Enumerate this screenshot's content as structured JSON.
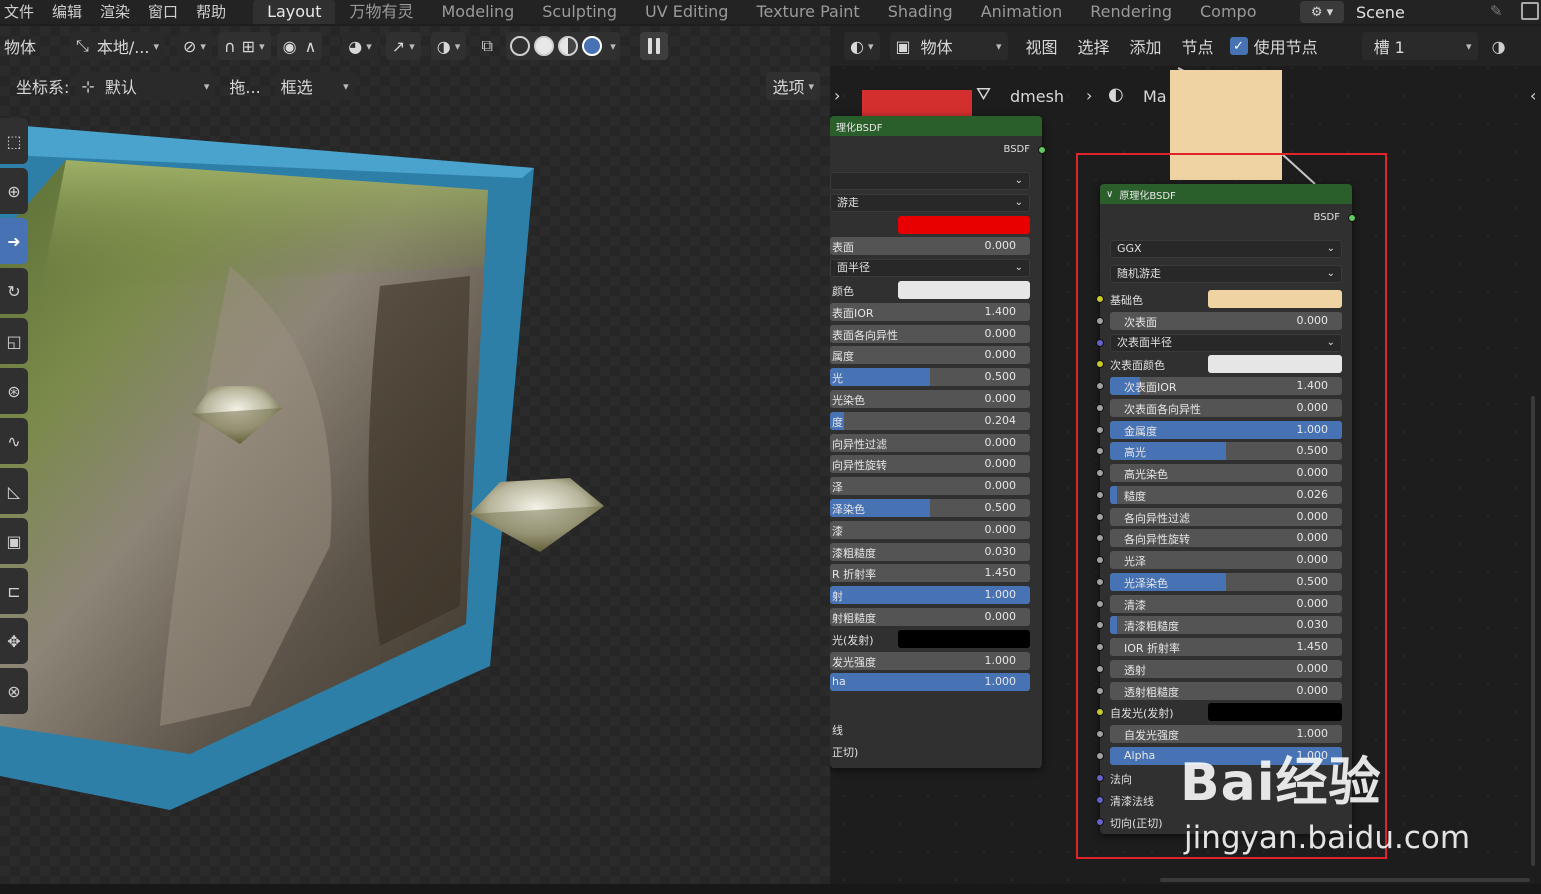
{
  "topbar": {
    "menus": [
      "文件",
      "编辑",
      "渲染",
      "窗口",
      "帮助"
    ],
    "workspaces": [
      "Layout",
      "万物有灵",
      "Modeling",
      "Sculpting",
      "UV Editing",
      "Texture Paint",
      "Shading",
      "Animation",
      "Rendering",
      "Compo"
    ],
    "active_workspace": "Layout",
    "scene_name": "Scene"
  },
  "viewport": {
    "mode_label": "物体",
    "orientation_label": "本地/...",
    "coord_label": "坐标系:",
    "coord_value": "默认",
    "drag_label": "拖...",
    "select_mode": "框选",
    "options_label": "选项"
  },
  "node_editor": {
    "object_label": "物体",
    "menus": [
      "视图",
      "选择",
      "添加",
      "节点"
    ],
    "use_nodes_label": "使用节点",
    "slot_label": "槽 1",
    "breadcrumb_mesh": "dmesh",
    "breadcrumb_mat": "Ma"
  },
  "left_node": {
    "title": "理化BSDF",
    "output": "BSDF",
    "rows": [
      {
        "label": "",
        "kind": "dropdown"
      },
      {
        "label": "游走",
        "kind": "dropdown"
      },
      {
        "label": "",
        "kind": "color",
        "color": "#e80000"
      },
      {
        "label": "表面",
        "value": "0.000",
        "fill": 0
      },
      {
        "label": "面半径",
        "kind": "dropdown"
      },
      {
        "label": "颜色",
        "kind": "color",
        "color": "#e6e6e6"
      },
      {
        "label": "表面IOR",
        "value": "1.400",
        "fill": 0
      },
      {
        "label": "表面各向异性",
        "value": "0.000",
        "fill": 0
      },
      {
        "label": "属度",
        "value": "0.000",
        "fill": 0
      },
      {
        "label": "光",
        "value": "0.500",
        "fill": 0.5
      },
      {
        "label": "光染色",
        "value": "0.000",
        "fill": 0
      },
      {
        "label": "度",
        "value": "0.204",
        "fill": 0.07
      },
      {
        "label": "向异性过滤",
        "value": "0.000",
        "fill": 0
      },
      {
        "label": "向异性旋转",
        "value": "0.000",
        "fill": 0
      },
      {
        "label": "泽",
        "value": "0.000",
        "fill": 0
      },
      {
        "label": "泽染色",
        "value": "0.500",
        "fill": 0.5
      },
      {
        "label": "漆",
        "value": "0.000",
        "fill": 0
      },
      {
        "label": "漆粗糙度",
        "value": "0.030",
        "fill": 0
      },
      {
        "label": "R 折射率",
        "value": "1.450",
        "fill": 0
      },
      {
        "label": "射",
        "value": "1.000",
        "fill": 1
      },
      {
        "label": "射粗糙度",
        "value": "0.000",
        "fill": 0
      },
      {
        "label": "光(发射)",
        "kind": "color",
        "color": "#000000"
      },
      {
        "label": "发光强度",
        "value": "1.000",
        "fill": 0
      },
      {
        "label": "ha",
        "value": "1.000",
        "fill": 1
      }
    ],
    "tail": [
      "线",
      "正切)"
    ]
  },
  "right_node": {
    "title": "原理化BSDF",
    "output": "BSDF",
    "distribution": "GGX",
    "subsurface_method": "随机游走",
    "rows": [
      {
        "label": "基础色",
        "kind": "color",
        "color": "#f0d3a3",
        "socket": "yellow"
      },
      {
        "label": "次表面",
        "value": "0.000",
        "fill": 0,
        "socket": "grey"
      },
      {
        "label": "次表面半径",
        "kind": "dropdown",
        "socket": "blue"
      },
      {
        "label": "次表面颜色",
        "kind": "color",
        "color": "#e6e6e6",
        "socket": "yellow"
      },
      {
        "label": "次表面IOR",
        "value": "1.400",
        "fill": 0.13,
        "socket": "grey"
      },
      {
        "label": "次表面各向异性",
        "value": "0.000",
        "fill": 0,
        "socket": "grey"
      },
      {
        "label": "金属度",
        "value": "1.000",
        "fill": 1,
        "socket": "grey"
      },
      {
        "label": "高光",
        "value": "0.500",
        "fill": 0.5,
        "socket": "grey"
      },
      {
        "label": "高光染色",
        "value": "0.000",
        "fill": 0,
        "socket": "grey"
      },
      {
        "label": "糙度",
        "value": "0.026",
        "fill": 0.03,
        "socket": "grey"
      },
      {
        "label": "各向异性过滤",
        "value": "0.000",
        "fill": 0,
        "socket": "grey"
      },
      {
        "label": "各向异性旋转",
        "value": "0.000",
        "fill": 0,
        "socket": "grey"
      },
      {
        "label": "光泽",
        "value": "0.000",
        "fill": 0,
        "socket": "grey"
      },
      {
        "label": "光泽染色",
        "value": "0.500",
        "fill": 0.5,
        "socket": "grey"
      },
      {
        "label": "清漆",
        "value": "0.000",
        "fill": 0,
        "socket": "grey"
      },
      {
        "label": "清漆粗糙度",
        "value": "0.030",
        "fill": 0.03,
        "socket": "grey"
      },
      {
        "label": "IOR 折射率",
        "value": "1.450",
        "fill": 0,
        "socket": "grey"
      },
      {
        "label": "透射",
        "value": "0.000",
        "fill": 0,
        "socket": "grey"
      },
      {
        "label": "透射粗糙度",
        "value": "0.000",
        "fill": 0,
        "socket": "grey"
      },
      {
        "label": "自发光(发射)",
        "kind": "color",
        "color": "#000000",
        "socket": "yellow"
      },
      {
        "label": "自发光强度",
        "value": "1.000",
        "fill": 0,
        "socket": "grey"
      },
      {
        "label": "Alpha",
        "value": "1.000",
        "fill": 1,
        "socket": "grey"
      }
    ],
    "vector_inputs": [
      "法向",
      "清漆法线",
      "切向(正切)"
    ]
  },
  "watermark": {
    "brand": "Bai经验",
    "url": "jingyan.baidu.com"
  }
}
